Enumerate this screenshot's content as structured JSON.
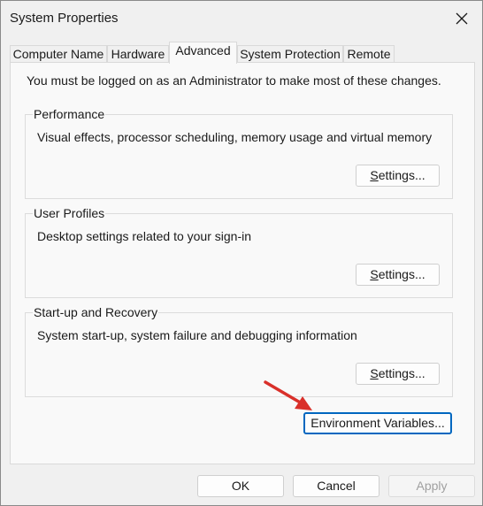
{
  "window": {
    "title": "System Properties"
  },
  "tabs": [
    {
      "label": "Computer Name"
    },
    {
      "label": "Hardware"
    },
    {
      "label": "Advanced"
    },
    {
      "label": "System Protection"
    },
    {
      "label": "Remote"
    }
  ],
  "active_tab": "Advanced",
  "intro": "You must be logged on as an Administrator to make most of these changes.",
  "groups": {
    "performance": {
      "title": "Performance",
      "description": "Visual effects, processor scheduling, memory usage and virtual memory",
      "button": {
        "mnemonic": "S",
        "rest": "ettings..."
      }
    },
    "user_profiles": {
      "title": "User Profiles",
      "description": "Desktop settings related to your sign-in",
      "button": {
        "mnemonic": "S",
        "rest": "ettings..."
      }
    },
    "startup_recovery": {
      "title": "Start-up and Recovery",
      "description": "System start-up, system failure and debugging information",
      "button": {
        "mnemonic": "S",
        "rest": "ettings..."
      }
    }
  },
  "env_button": {
    "before": "Environment Variables",
    "mnemonic": "",
    "after": "..."
  },
  "footer": {
    "ok": "OK",
    "cancel": "Cancel",
    "apply": "Apply"
  },
  "colors": {
    "accent": "#0067c0",
    "arrow": "#d9302a"
  }
}
